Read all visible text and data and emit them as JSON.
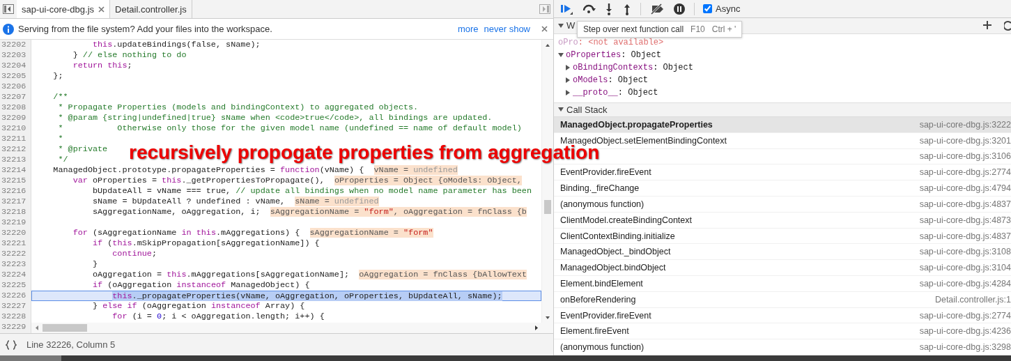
{
  "tabs": [
    {
      "label": "sap-ui-core-dbg.js",
      "selected": true,
      "closable": true
    },
    {
      "label": "Detail.controller.js",
      "selected": false,
      "closable": false
    }
  ],
  "infobar": {
    "message": "Serving from the file system? Add your files into the workspace.",
    "links": [
      "more",
      "never show"
    ]
  },
  "code": {
    "lines": [
      {
        "number": "32202",
        "current": false,
        "tokens": [
          {
            "kind": "kw",
            "text": "            this"
          },
          {
            "kind": "pl",
            "text": ".updateBindings(false, sName);"
          }
        ]
      },
      {
        "number": "32203",
        "current": false,
        "tokens": [
          {
            "kind": "pl",
            "text": "        } "
          },
          {
            "kind": "com",
            "text": "// else nothing to do"
          }
        ]
      },
      {
        "number": "32204",
        "current": false,
        "tokens": [
          {
            "kind": "kw",
            "text": "        return this"
          },
          {
            "kind": "pl",
            "text": ";"
          }
        ]
      },
      {
        "number": "32205",
        "current": false,
        "tokens": [
          {
            "kind": "pl",
            "text": "    };"
          }
        ]
      },
      {
        "number": "32206"
      },
      {
        "number": "32207",
        "current": false,
        "tokens": [
          {
            "kind": "com",
            "text": "    /**"
          }
        ]
      },
      {
        "number": "32208",
        "current": false,
        "tokens": [
          {
            "kind": "com",
            "text": "     * Propagate Properties (models and bindingContext) to aggregated objects."
          }
        ]
      },
      {
        "number": "32209",
        "current": false,
        "tokens": [
          {
            "kind": "com",
            "text": "     * @param {string|undefined|true} sName when <code>true</code>, all bindings are updated."
          }
        ]
      },
      {
        "number": "32210",
        "current": false,
        "tokens": [
          {
            "kind": "com",
            "text": "     *           Otherwise only those for the given model name (undefined == name of default model)"
          }
        ]
      },
      {
        "number": "32211",
        "current": false,
        "tokens": [
          {
            "kind": "com",
            "text": "     *"
          }
        ]
      },
      {
        "number": "32212",
        "current": false,
        "tokens": [
          {
            "kind": "com",
            "text": "     * @private"
          }
        ]
      },
      {
        "number": "32213",
        "current": false,
        "tokens": [
          {
            "kind": "com",
            "text": "     */"
          }
        ]
      },
      {
        "number": "32214",
        "current": false,
        "tokens": [
          {
            "kind": "pl",
            "text": "    ManagedObject.prototype.propagateProperties = "
          },
          {
            "kind": "kw",
            "text": "function"
          },
          {
            "kind": "pl",
            "text": "(vName) {  "
          },
          {
            "kind": "val",
            "text": "vName = "
          },
          {
            "kind": "valdim",
            "text": "undefined"
          }
        ]
      },
      {
        "number": "32215",
        "current": false,
        "tokens": [
          {
            "kind": "kw",
            "text": "        var"
          },
          {
            "kind": "pl",
            "text": " oProperties = "
          },
          {
            "kind": "kw",
            "text": "this"
          },
          {
            "kind": "pl",
            "text": "._getPropertiesToPropagate(),  "
          },
          {
            "kind": "val",
            "text": "oProperties = Object {oModels: Object,"
          }
        ]
      },
      {
        "number": "32216",
        "current": false,
        "tokens": [
          {
            "kind": "pl",
            "text": "            bUpdateAll = vName === true, "
          },
          {
            "kind": "com",
            "text": "// update all bindings when no model name parameter has been"
          }
        ]
      },
      {
        "number": "32217",
        "current": false,
        "tokens": [
          {
            "kind": "pl",
            "text": "            sName = bUpdateAll ? undefined : vName,  "
          },
          {
            "kind": "val",
            "text": "sName = "
          },
          {
            "kind": "valdim",
            "text": "undefined"
          }
        ]
      },
      {
        "number": "32218",
        "current": false,
        "tokens": [
          {
            "kind": "pl",
            "text": "            sAggregationName, oAggregation, i;  "
          },
          {
            "kind": "val",
            "text": "sAggregationName = "
          },
          {
            "kind": "valstr",
            "text": "\"form\""
          },
          {
            "kind": "val",
            "text": ", oAggregation = fnClass {b"
          }
        ]
      },
      {
        "number": "32219"
      },
      {
        "number": "32220",
        "current": false,
        "tokens": [
          {
            "kind": "kw",
            "text": "        for"
          },
          {
            "kind": "pl",
            "text": " (sAggregationName "
          },
          {
            "kind": "kw",
            "text": "in this"
          },
          {
            "kind": "pl",
            "text": ".mAggregations) {  "
          },
          {
            "kind": "val",
            "text": "sAggregationName = "
          },
          {
            "kind": "valstr",
            "text": "\"form\""
          }
        ]
      },
      {
        "number": "32221",
        "current": false,
        "tokens": [
          {
            "kind": "kw",
            "text": "            if"
          },
          {
            "kind": "pl",
            "text": " ("
          },
          {
            "kind": "kw",
            "text": "this"
          },
          {
            "kind": "pl",
            "text": ".mSkipPropagation[sAggregationName]) {"
          }
        ]
      },
      {
        "number": "32222",
        "current": false,
        "tokens": [
          {
            "kind": "kw",
            "text": "                continue"
          },
          {
            "kind": "pl",
            "text": ";"
          }
        ]
      },
      {
        "number": "32223",
        "current": false,
        "tokens": [
          {
            "kind": "pl",
            "text": "            }"
          }
        ]
      },
      {
        "number": "32224",
        "current": false,
        "tokens": [
          {
            "kind": "pl",
            "text": "            oAggregation = "
          },
          {
            "kind": "kw",
            "text": "this"
          },
          {
            "kind": "pl",
            "text": ".mAggregations[sAggregationName];  "
          },
          {
            "kind": "val",
            "text": "oAggregation = fnClass {bAllowText"
          }
        ]
      },
      {
        "number": "32225",
        "current": false,
        "tokens": [
          {
            "kind": "kw",
            "text": "            if"
          },
          {
            "kind": "pl",
            "text": " (oAggregation "
          },
          {
            "kind": "kw",
            "text": "instanceof"
          },
          {
            "kind": "pl",
            "text": " ManagedObject) {"
          }
        ]
      },
      {
        "number": "32226",
        "current": true,
        "tokens": [
          {
            "kind": "kwsel",
            "text": "                this"
          },
          {
            "kind": "plsel",
            "text": "._propagateProperties(vName, oAggregation, oProperties, bUpdateAll, sName);"
          }
        ]
      },
      {
        "number": "32227",
        "current": false,
        "tokens": [
          {
            "kind": "pl",
            "text": "            } "
          },
          {
            "kind": "kw",
            "text": "else if"
          },
          {
            "kind": "pl",
            "text": " (oAggregation "
          },
          {
            "kind": "kw",
            "text": "instanceof"
          },
          {
            "kind": "pl",
            "text": " Array) {"
          }
        ]
      },
      {
        "number": "32228",
        "current": false,
        "tokens": [
          {
            "kind": "kw",
            "text": "                for"
          },
          {
            "kind": "pl",
            "text": " (i = "
          },
          {
            "kind": "num",
            "text": "0"
          },
          {
            "kind": "pl",
            "text": "; i < oAggregation.length; i++) {"
          }
        ]
      },
      {
        "number": "32229"
      }
    ]
  },
  "status": {
    "position": "Line 32226, Column 5"
  },
  "debugger_toolbar": {
    "async": {
      "label": "Async",
      "checked": true
    }
  },
  "tooltip": {
    "text": "Step over next function call",
    "shortcuts": [
      "F10",
      "Ctrl + '"
    ]
  },
  "watch": {
    "title": "W",
    "items": [
      {
        "name": "oPro",
        "value": ": <not available>",
        "available": false
      },
      {
        "name": "oProperties",
        "value": ": Object",
        "available": true,
        "expanded": true,
        "children": [
          {
            "name": "oBindingContexts",
            "value": ": Object",
            "available": true,
            "expanded": false
          },
          {
            "name": "oModels",
            "value": ": Object",
            "available": true,
            "expanded": false
          },
          {
            "name": "__proto__",
            "value": ": Object",
            "available": true,
            "expanded": false
          }
        ]
      }
    ]
  },
  "call_stack": {
    "title": "Call Stack",
    "frames": [
      {
        "name": "ManagedObject.propagateProperties",
        "location": "sap-ui-core-dbg.js:3222",
        "selected": true
      },
      {
        "name": "ManagedObject.setElementBindingContext",
        "location": "sap-ui-core-dbg.js:3201",
        "selected": false
      },
      {
        "location": "sap-ui-core-dbg.js:3106",
        "selected": false
      },
      {
        "name": "EventProvider.fireEvent",
        "location": "sap-ui-core-dbg.js:2774",
        "selected": false
      },
      {
        "name": "Binding._fireChange",
        "location": "sap-ui-core-dbg.js:4794",
        "selected": false
      },
      {
        "name": "(anonymous function)",
        "location": "sap-ui-core-dbg.js:4837",
        "selected": false
      },
      {
        "name": "ClientModel.createBindingContext",
        "location": "sap-ui-core-dbg.js:4873",
        "selected": false
      },
      {
        "name": "ClientContextBinding.initialize",
        "location": "sap-ui-core-dbg.js:4837",
        "selected": false
      },
      {
        "name": "ManagedObject._bindObject",
        "location": "sap-ui-core-dbg.js:3108",
        "selected": false
      },
      {
        "name": "ManagedObject.bindObject",
        "location": "sap-ui-core-dbg.js:3104",
        "selected": false
      },
      {
        "name": "Element.bindElement",
        "location": "sap-ui-core-dbg.js:4284",
        "selected": false
      },
      {
        "name": "onBeforeRendering",
        "location": "Detail.controller.js:1",
        "selected": false
      },
      {
        "name": "EventProvider.fireEvent",
        "location": "sap-ui-core-dbg.js:2774",
        "selected": false
      },
      {
        "name": "Element.fireEvent",
        "location": "sap-ui-core-dbg.js:4236",
        "selected": false
      },
      {
        "name": "(anonymous function)",
        "location": "sap-ui-core-dbg.js:3298",
        "selected": false
      }
    ]
  },
  "annotation": "recursively propogate properties from aggregation"
}
